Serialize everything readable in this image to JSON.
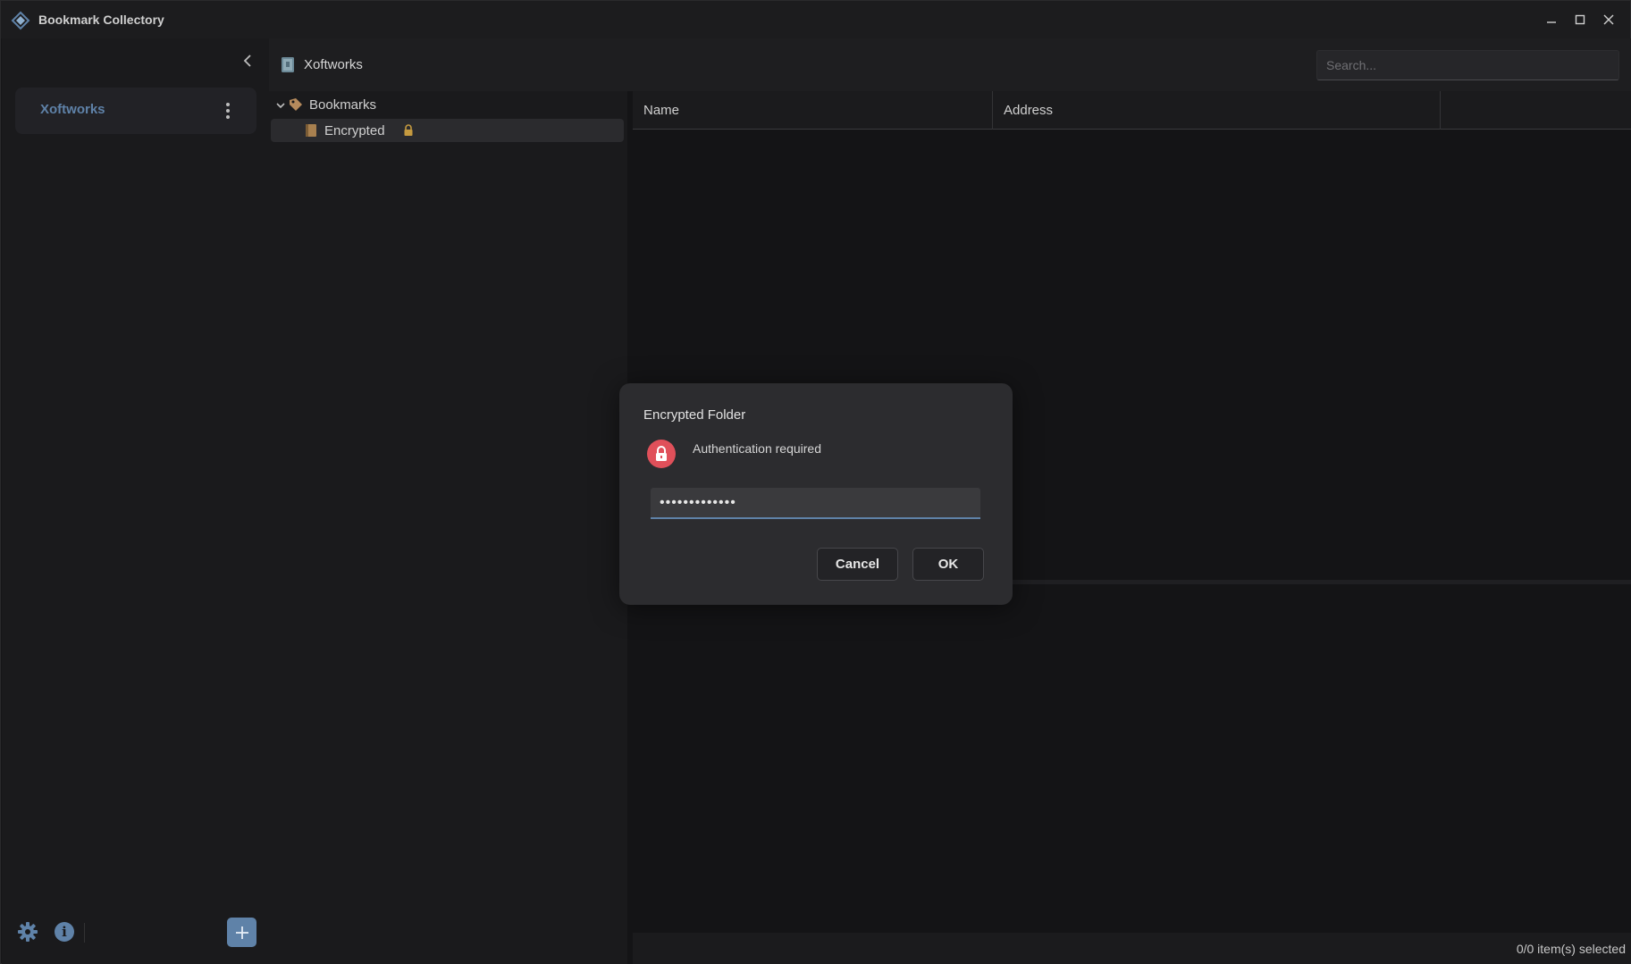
{
  "app": {
    "title": "Bookmark Collectory",
    "accent": "#5f82a8"
  },
  "sidebar": {
    "collections": [
      {
        "label": "Xoftworks"
      }
    ]
  },
  "header": {
    "collection_title": "Xoftworks",
    "search": {
      "placeholder": "Search...",
      "value": ""
    }
  },
  "tree": {
    "items": [
      {
        "label": "Bookmarks",
        "expanded": true
      },
      {
        "label": "Encrypted",
        "selected": true,
        "locked": true
      }
    ]
  },
  "table": {
    "columns": [
      {
        "label": "Name"
      },
      {
        "label": "Address"
      }
    ]
  },
  "status": {
    "text": "0/0 item(s) selected"
  },
  "dialog": {
    "title": "Encrypted Folder",
    "message": "Authentication required",
    "password_value": "•••••••••••••",
    "cancel_label": "Cancel",
    "ok_label": "OK",
    "icon_color": "#e0505a"
  }
}
